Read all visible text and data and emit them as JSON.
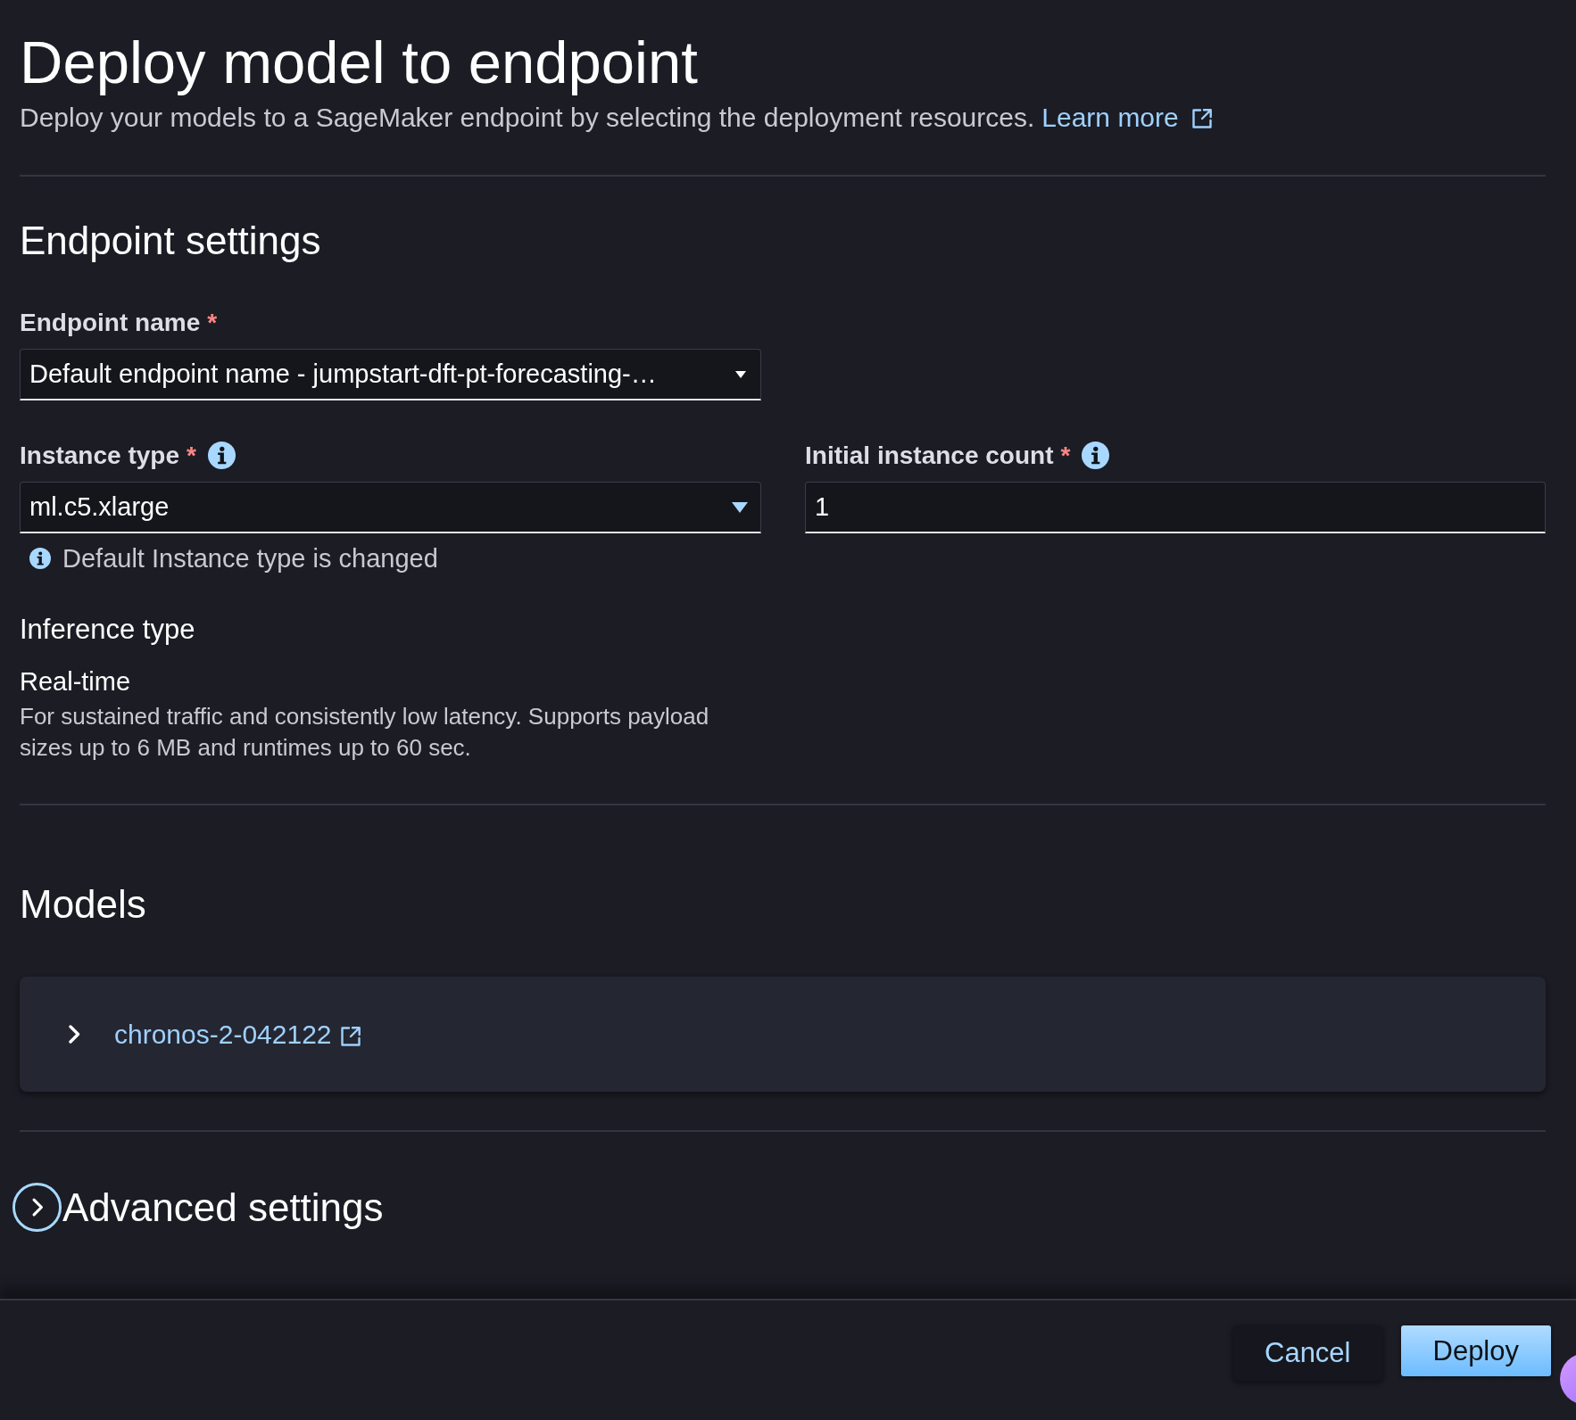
{
  "header": {
    "title": "Deploy model to endpoint",
    "description": "Deploy your models to a SageMaker endpoint by selecting the deployment resources.",
    "link": "Learn more"
  },
  "endpoint_settings": {
    "heading": "Endpoint settings",
    "rows": [
      [
        {
          "kind": "combobox",
          "label": "Endpoint name",
          "required_mark": "*",
          "info": false,
          "value": "Default endpoint name - jumpstart-dft-pt-forecasting-…"
        }
      ],
      [
        {
          "kind": "select",
          "label": "Instance type",
          "required_mark": "*",
          "info": true,
          "value": "ml.c5.xlarge",
          "hint": "Default Instance type is changed"
        },
        {
          "kind": "input",
          "label": "Initial instance count",
          "required_mark": "*",
          "info": true,
          "value": "1"
        }
      ]
    ],
    "inference_type": {
      "label": "Inference type",
      "option": "Real-time",
      "description": "For sustained traffic and consistently low latency. Supports payload sizes up to 6 MB and runtimes up to 60 sec."
    }
  },
  "models": {
    "heading": "Models",
    "items": [
      {
        "name": "chronos-2-042122",
        "expanded": false
      }
    ]
  },
  "advanced_settings": {
    "heading": "Advanced settings",
    "expanded": false
  },
  "footer": {
    "buttons": [
      {
        "label": "Cancel",
        "kind": "normal"
      },
      {
        "label": "Deploy",
        "kind": "primary"
      }
    ]
  }
}
